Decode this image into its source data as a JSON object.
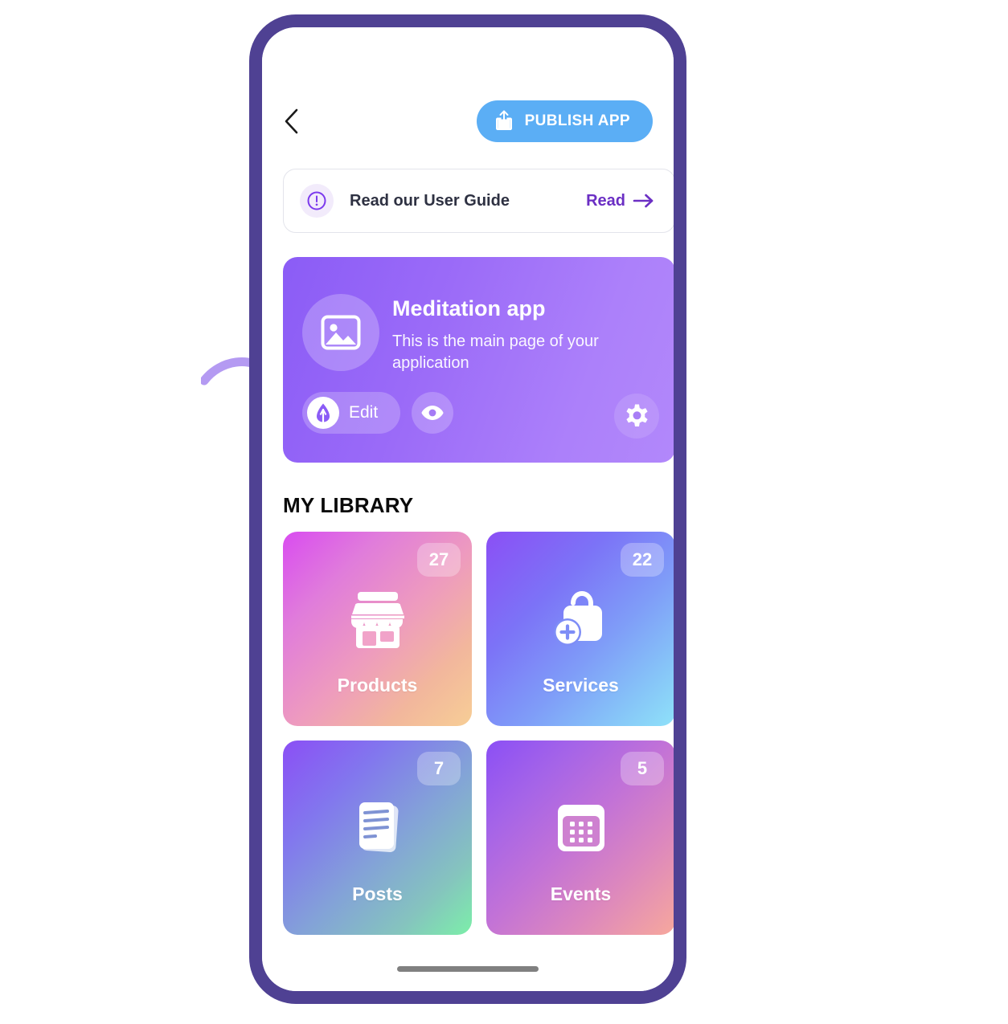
{
  "header": {
    "back_icon": "chevron-left-icon",
    "publish_button": {
      "label": "PUBLISH APP",
      "icon": "upload-share-icon",
      "color": "#5BAEF5"
    }
  },
  "banner": {
    "icon": "alert-circle-icon",
    "title": "Read our User Guide",
    "action_label": "Read",
    "action_icon": "arrow-right-icon",
    "action_color": "#6B2FC4"
  },
  "main_page_card": {
    "thumbnail_icon": "image-placeholder-icon",
    "title": "Meditation app",
    "subtitle": "This is the main page of your application",
    "edit_button": {
      "label": "Edit",
      "icon": "pen-nib-icon"
    },
    "preview_button": {
      "icon": "eye-icon"
    },
    "settings_button": {
      "icon": "gear-icon"
    },
    "gradient_from": "#8B5CF6",
    "gradient_to": "#B288FB"
  },
  "library": {
    "heading": "MY LIBRARY",
    "cards": [
      {
        "label": "Products",
        "count": "27",
        "icon": "storefront-icon",
        "gradient_from": "#D94CF0",
        "gradient_to": "#F7CE96"
      },
      {
        "label": "Services",
        "count": "22",
        "icon": "shopping-bag-plus-icon",
        "gradient_from": "#8B4FF5",
        "gradient_to": "#8FE2F9"
      },
      {
        "label": "Posts",
        "count": "7",
        "icon": "documents-icon",
        "gradient_from": "#8B4FF5",
        "gradient_to": "#7CEFA9"
      },
      {
        "label": "Events",
        "count": "5",
        "icon": "calendar-icon",
        "gradient_from": "#8B4FF5",
        "gradient_to": "#F7A89C"
      }
    ]
  },
  "device": {
    "frame_color": "#4F4193",
    "home_indicator_color": "#808080"
  },
  "annotation": {
    "arrow_icon": "curved-arrow-icon",
    "arrow_color": "#B49AF2"
  }
}
